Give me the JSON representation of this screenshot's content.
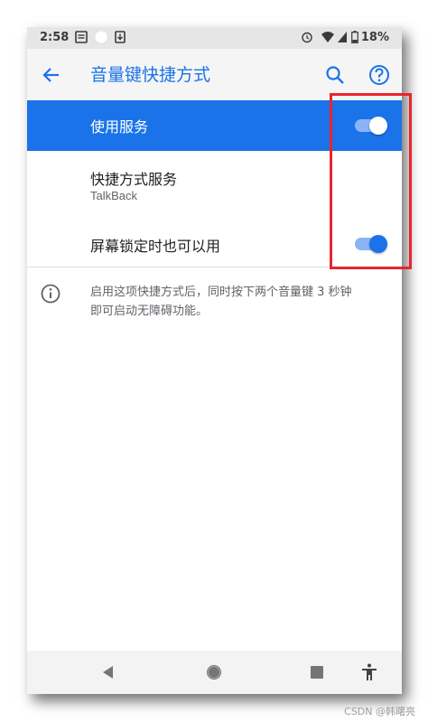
{
  "status_bar": {
    "time": "2:58",
    "battery": "18%"
  },
  "app_bar": {
    "title": "音量键快捷方式"
  },
  "settings": {
    "use_service": {
      "label": "使用服务",
      "enabled": true
    },
    "shortcut_service": {
      "label": "快捷方式服务",
      "value": "TalkBack"
    },
    "lock_screen": {
      "label": "屏幕锁定时也可以用",
      "enabled": true
    }
  },
  "info": {
    "text_line1": "启用这项快捷方式后，同时按下两个音量键 3 秒钟",
    "text_line2": "即可启动无障碍功能。"
  },
  "icons": {
    "back": "back-arrow-icon",
    "search": "search-icon",
    "help": "help-icon",
    "info": "info-icon",
    "nav_back": "nav-back-icon",
    "nav_home": "nav-home-icon",
    "nav_recents": "nav-recents-icon",
    "accessibility": "accessibility-icon"
  },
  "colors": {
    "accent": "#1a73e8",
    "switch_track": "#8ab4f8",
    "annotation": "#e8252b"
  },
  "watermark": "CSDN @韩曙亮"
}
